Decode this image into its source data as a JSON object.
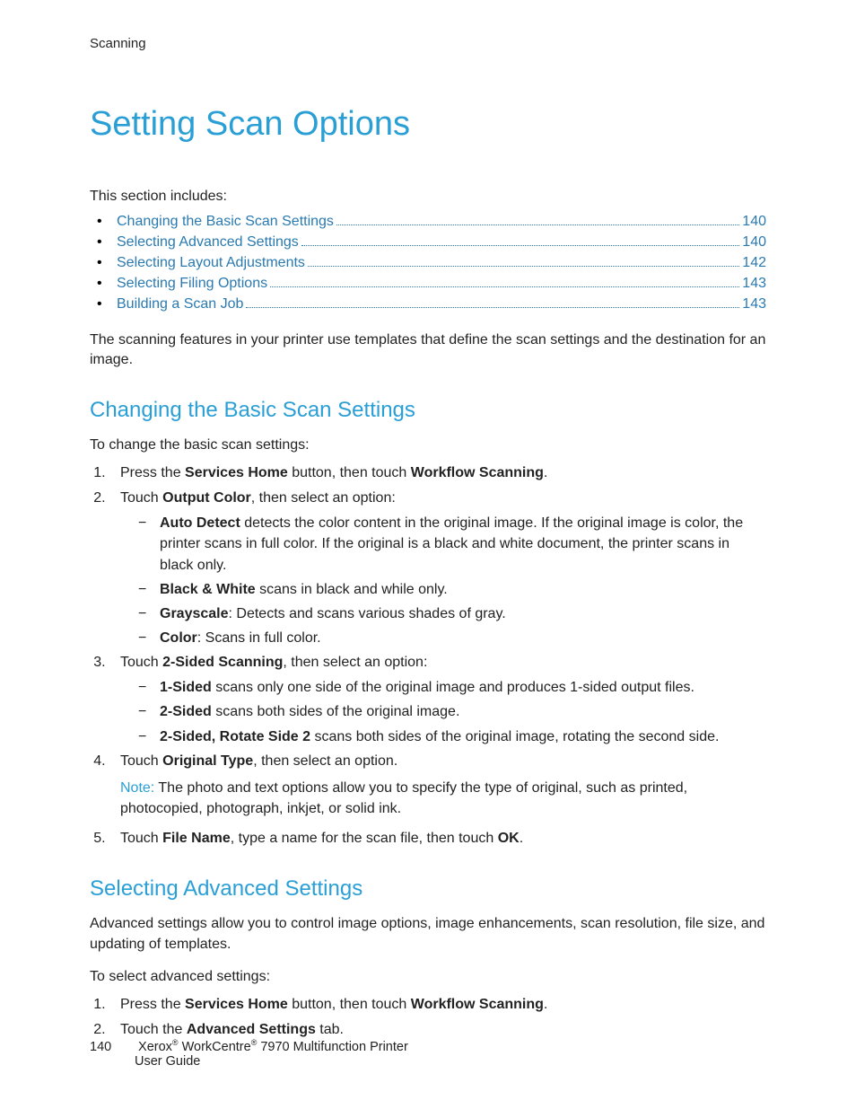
{
  "header": {
    "chapter": "Scanning"
  },
  "title": "Setting Scan Options",
  "section_intro": "This section includes:",
  "toc": [
    {
      "label": "Changing the Basic Scan Settings",
      "page": "140"
    },
    {
      "label": "Selecting Advanced Settings",
      "page": "140"
    },
    {
      "label": "Selecting Layout Adjustments",
      "page": "142"
    },
    {
      "label": "Selecting Filing Options",
      "page": "143"
    },
    {
      "label": "Building a Scan Job",
      "page": "143"
    }
  ],
  "lead_paragraph": "The scanning features in your printer use templates that define the scan settings and the destination for an image.",
  "sec1": {
    "heading": "Changing the Basic Scan Settings",
    "intro": "To change the basic scan settings:",
    "step1_a": "Press the ",
    "step1_b": "Services Home",
    "step1_c": " button, then touch ",
    "step1_d": "Workflow Scanning",
    "step1_e": ".",
    "step2_a": "Touch ",
    "step2_b": "Output Color",
    "step2_c": ", then select an option:",
    "s2_items": {
      "auto_b": "Auto Detect",
      "auto_t": " detects the color content in the original image. If the original image is color, the printer scans in full color. If the original is a black and white document, the printer scans in black only.",
      "bw_b": "Black & White",
      "bw_t": " scans in black and while only.",
      "gray_b": "Grayscale",
      "gray_t": ": Detects and scans various shades of gray.",
      "color_b": "Color",
      "color_t": ": Scans in full color."
    },
    "step3_a": "Touch ",
    "step3_b": "2-Sided Scanning",
    "step3_c": ", then select an option:",
    "s3_items": {
      "one_b": "1-Sided",
      "one_t": " scans only one side of the original image and produces 1-sided output files.",
      "two_b": "2-Sided",
      "two_t": " scans both sides of the original image.",
      "rot_b": "2-Sided, Rotate Side 2",
      "rot_t": " scans both sides of the original image, rotating the second side."
    },
    "step4_a": "Touch ",
    "step4_b": "Original Type",
    "step4_c": ", then select an option.",
    "note_label": "Note:",
    "note_text": " The photo and text options allow you to specify the type of original, such as printed, photocopied, photograph, inkjet, or solid ink.",
    "step5_a": "Touch ",
    "step5_b": "File Name",
    "step5_c": ", type a name for the scan file, then touch ",
    "step5_d": "OK",
    "step5_e": "."
  },
  "sec2": {
    "heading": "Selecting Advanced Settings",
    "p1": "Advanced settings allow you to control image options, image enhancements, scan resolution, file size, and updating of templates.",
    "p2": "To select advanced settings:",
    "step1_a": "Press the ",
    "step1_b": "Services Home",
    "step1_c": " button, then touch ",
    "step1_d": "Workflow Scanning",
    "step1_e": ".",
    "step2_a": "Touch the ",
    "step2_b": "Advanced Settings",
    "step2_c": " tab."
  },
  "footer": {
    "page_number": "140",
    "brand1": "Xerox",
    "brand2": " WorkCentre",
    "model": " 7970 Multifunction Printer",
    "line2": "User Guide"
  }
}
